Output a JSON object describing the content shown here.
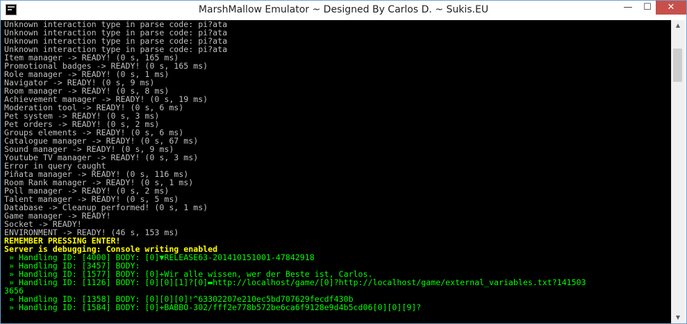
{
  "window": {
    "title": "MarshMallow Emulator ~ Designed By Carlos D. ~ Sukis.EU",
    "min_glyph": "—",
    "max_glyph": "☐",
    "close_glyph": "✕"
  },
  "scrollbar": {
    "up_glyph": "▲",
    "down_glyph": "▼",
    "position_fraction": 0.05
  },
  "colors": {
    "console_background": "#000000",
    "default_text": "#c0c0c0",
    "warning_text": "#ffff00",
    "packet_text": "#00ff00",
    "close_button": "#c7504b"
  },
  "console": {
    "lines": [
      {
        "text": "Unknown interaction type in parse code: pi?ata",
        "style": "gray"
      },
      {
        "text": "Unknown interaction type in parse code: pi?ata",
        "style": "gray"
      },
      {
        "text": "Unknown interaction type in parse code: pi?ata",
        "style": "gray"
      },
      {
        "text": "Unknown interaction type in parse code: pi?ata",
        "style": "gray"
      },
      {
        "text": "Item manager -> READY! (0 s, 165 ms)",
        "style": "gray"
      },
      {
        "text": "Promotional badges -> READY! (0 s, 165 ms)",
        "style": "gray"
      },
      {
        "text": "Role manager -> READY! (0 s, 1 ms)",
        "style": "gray"
      },
      {
        "text": "Navigator -> READY! (0 s, 9 ms)",
        "style": "gray"
      },
      {
        "text": "Room manager -> READY! (0 s, 8 ms)",
        "style": "gray"
      },
      {
        "text": "Achievement manager -> READY! (0 s, 19 ms)",
        "style": "gray"
      },
      {
        "text": "Moderation tool -> READY! (0 s, 6 ms)",
        "style": "gray"
      },
      {
        "text": "Pet system -> READY! (0 s, 3 ms)",
        "style": "gray"
      },
      {
        "text": "Pet orders -> READY! (0 s, 2 ms)",
        "style": "gray"
      },
      {
        "text": "Groups elements -> READY! (0 s, 6 ms)",
        "style": "gray"
      },
      {
        "text": "Catalogue manager -> READY! (0 s, 67 ms)",
        "style": "gray"
      },
      {
        "text": "Sound manager -> READY! (0 s, 9 ms)",
        "style": "gray"
      },
      {
        "text": "Youtube TV manager -> READY! (0 s, 3 ms)",
        "style": "gray"
      },
      {
        "text": "Error in query caught",
        "style": "gray"
      },
      {
        "text": "Piñata manager -> READY! (0 s, 116 ms)",
        "style": "gray"
      },
      {
        "text": "Room Rank manager -> READY! (0 s, 1 ms)",
        "style": "gray"
      },
      {
        "text": "Poll manager -> READY! (0 s, 2 ms)",
        "style": "gray"
      },
      {
        "text": "Talent manager -> READY! (0 s, 5 ms)",
        "style": "gray"
      },
      {
        "text": "Database -> Cleanup performed! (0 s, 1 ms)",
        "style": "gray"
      },
      {
        "text": "Game manager -> READY!",
        "style": "gray"
      },
      {
        "text": "Socket -> READY!",
        "style": "gray"
      },
      {
        "text": "ENVIRONMENT -> READY! (46 s, 153 ms)",
        "style": "gray"
      },
      {
        "text": "REMEMBER PRESSING ENTER!",
        "style": "yellow"
      },
      {
        "text": "Server is debugging: Console writing enabled",
        "style": "yellow"
      },
      {
        "text": " » Handling ID: [4000] BODY: [0]▼RELEASE63-201410151001-47842918",
        "style": "green"
      },
      {
        "text": " » Handling ID: [3457] BODY:",
        "style": "green"
      },
      {
        "text": " » Handling ID: [1577] BODY: [0]+Wir alle wissen, wer der Beste ist, Carlos.",
        "style": "green"
      },
      {
        "text": " » Handling ID: [1126] BODY: [0][0][1]?[0]▬http://localhost/game/[0]?http://localhost/game/external_variables.txt?141503",
        "style": "green"
      },
      {
        "text": "3656",
        "style": "green"
      },
      {
        "text": " » Handling ID: [1358] BODY: [0][0][0]!^63302207e210ec5bd707629fecdf430b",
        "style": "green"
      },
      {
        "text": " » Handling ID: [1584] BODY: [0]+BABBO-302/fff2e778b572be6ca6f9128e9d4b5cd06[0][0][9]?",
        "style": "green"
      }
    ]
  }
}
